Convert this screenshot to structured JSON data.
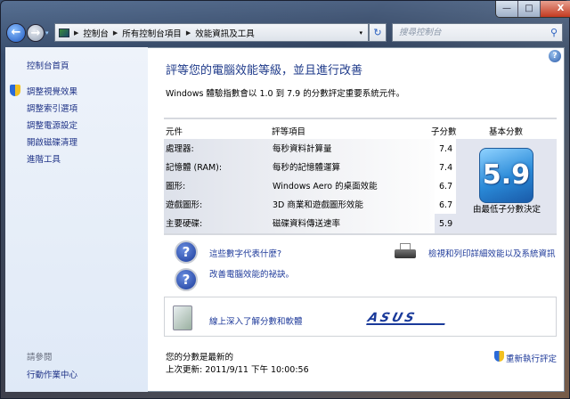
{
  "window": {
    "minimize": "—",
    "maximize": "□",
    "close": "X"
  },
  "nav": {
    "back": "←",
    "forward": "→",
    "history": "▾"
  },
  "address": {
    "breadcrumbs": [
      "控制台",
      "所有控制台項目",
      "效能資訊及工具"
    ],
    "refresh": "↻",
    "dropdown": "▾"
  },
  "search": {
    "placeholder": "搜尋控制台",
    "icon": "⚲"
  },
  "sidebar": {
    "home": "控制台首頁",
    "items": [
      "調整視覺效果",
      "調整索引選項",
      "調整電源設定",
      "開啟磁碟清理",
      "進階工具"
    ],
    "see_also": "請參閱",
    "see_also_items": [
      "行動作業中心"
    ]
  },
  "main": {
    "title": "評等您的電腦效能等級，並且進行改善",
    "description": "Windows 體驗指數會以 1.0 到 7.9 的分數評定重要系統元件。",
    "table": {
      "headers": [
        "元件",
        "評等項目",
        "子分數",
        "基本分數"
      ],
      "rows": [
        {
          "component": "處理器:",
          "item": "每秒資料計算量",
          "score": "7.4"
        },
        {
          "component": "記憶體 (RAM):",
          "item": "每秒的記憶體運算",
          "score": "7.4"
        },
        {
          "component": "圖形:",
          "item": "Windows Aero 的桌面效能",
          "score": "6.7"
        },
        {
          "component": "遊戲圖形:",
          "item": "3D 商業和遊戲圖形效能",
          "score": "6.7"
        },
        {
          "component": "主要硬碟:",
          "item": "磁碟資料傳送速率",
          "score": "5.9"
        }
      ],
      "base_score": "5.9",
      "base_caption": "由最低子分數決定"
    },
    "links": {
      "what_numbers": "這些數字代表什麼?",
      "tips": "改善電腦效能的祕訣。",
      "print": "檢視和列印詳細效能以及系統資訊",
      "online": "線上深入了解分數和軟體"
    },
    "logo": "ASUS",
    "status": "您的分數是最新的",
    "last_update": "上次更新: 2011/9/11 下午 10:00:56",
    "rerun": "重新執行評定"
  },
  "colors": {
    "link": "#1e3a9a",
    "title": "#1e3a8a"
  }
}
